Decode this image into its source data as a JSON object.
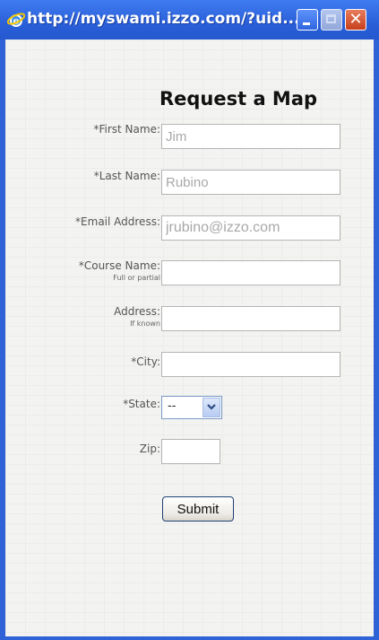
{
  "window": {
    "title": "http://myswami.izzo.com/?uid...",
    "close_glyph": "✕",
    "buttons": [
      "minimize",
      "maximize",
      "close"
    ],
    "accent_color": "#2f62d6",
    "browser_icon": "ie-icon"
  },
  "form": {
    "heading": "Request a Map",
    "fields": {
      "first_name": {
        "label": "*First Name:",
        "value": "Jim"
      },
      "last_name": {
        "label": "*Last Name:",
        "value": "Rubino"
      },
      "email": {
        "label": "*Email Address:",
        "value": "jrubino@izzo.com"
      },
      "course_name": {
        "label": "*Course Name:",
        "sublabel": "Full or partial",
        "value": ""
      },
      "address": {
        "label": "Address:",
        "sublabel": "If known",
        "value": ""
      },
      "city": {
        "label": "*City:",
        "value": ""
      },
      "state": {
        "label": "*State:",
        "selected": "--"
      },
      "zip": {
        "label": "Zip:",
        "value": ""
      }
    },
    "submit_label": "Submit"
  }
}
